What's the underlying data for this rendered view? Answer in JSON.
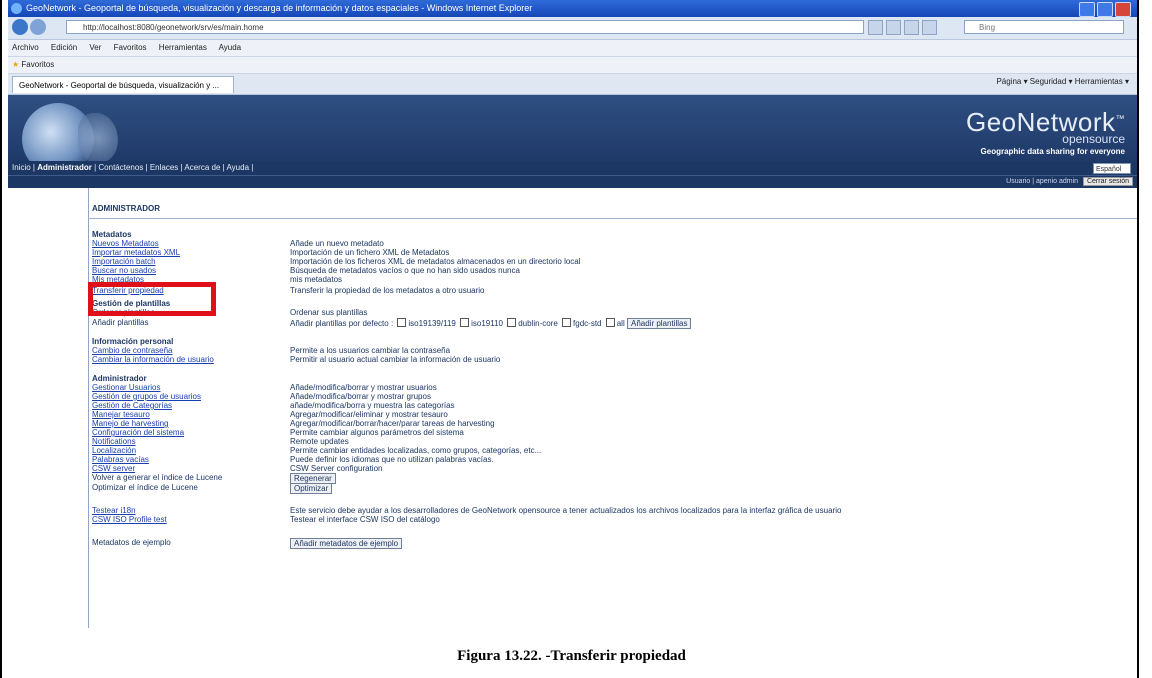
{
  "window": {
    "title": "GeoNetwork - Geoportal de búsqueda, visualización y descarga de información y datos espaciales - Windows Internet Explorer"
  },
  "address": {
    "url": "http://localhost:8080/geonetwork/srv/es/main.home",
    "search_placeholder": "Bing"
  },
  "menubar": [
    "Archivo",
    "Edición",
    "Ver",
    "Favoritos",
    "Herramientas",
    "Ayuda"
  ],
  "favorites": {
    "label": "Favoritos"
  },
  "tab": {
    "label": "GeoNetwork - Geoportal de búsqueda, visualización y ..."
  },
  "commandbar": {
    "text": "Página ▾  Seguridad ▾  Herramientas ▾"
  },
  "brand": {
    "name": "GeoNetwork",
    "tm": "™",
    "sub": "opensource",
    "tagline": "Geographic data sharing for everyone"
  },
  "nav": {
    "items": "Inicio | ",
    "active": "Administrador",
    "rest": " | Contáctenos | Enlaces | Acerca de | Ayuda |",
    "lang": "Español"
  },
  "userbar": {
    "text": "Usuario | apenio admin",
    "logout": "Cerrar sesión"
  },
  "admin": {
    "heading": "ADMINISTRADOR"
  },
  "sections": {
    "metadatos": "Metadatos",
    "plantillas": "Gestión de plantillas",
    "personal": "Información personal",
    "administrador": "Administrador"
  },
  "metadatos": [
    {
      "label": "Nuevos Metadatos",
      "desc": "Añade un nuevo metadato"
    },
    {
      "label": "Importar metadatos XML",
      "desc": "Importación de un fichero XML de Metadatos"
    },
    {
      "label": "Importación batch",
      "desc": "Importación de los ficheros XML de metadatos almacenados en un directorio local"
    },
    {
      "label": "Buscar no usados",
      "desc": "Búsqueda de metadatos vacíos o que no han sido usados nunca"
    },
    {
      "label": "Mis metadatos",
      "desc": "mis metadatos"
    },
    {
      "label": "Transferir propiedad",
      "desc": "Transferir la propiedad de los metadatos a otro usuario"
    }
  ],
  "plantillas": [
    {
      "label": "Ordenar plantillas",
      "desc": "Ordenar sus plantillas"
    },
    {
      "label": "Añadir plantillas",
      "desc": "Añadir plantillas por defecto :"
    }
  ],
  "template_options": [
    "iso19139/119",
    "iso19110",
    "dublin-core",
    "fgdc-std",
    "all"
  ],
  "template_button": "Añadir plantillas",
  "personal": [
    {
      "label": "Cambio de contraseña",
      "desc": "Permite a los usuarios cambiar la contraseña"
    },
    {
      "label": "Cambiar la información de usuario",
      "desc": "Permitir al usuario actual cambiar la información de usuario"
    }
  ],
  "administrador": [
    {
      "label": "Gestionar Usuarios",
      "desc": "Añade/modifica/borrar y mostrar usuarios"
    },
    {
      "label": "Gestión de grupos de usuarios",
      "desc": "Añade/modifica/borrar y mostrar grupos"
    },
    {
      "label": "Gestión de Categorías",
      "desc": "añade/modifica/borra y muestra las categorías"
    },
    {
      "label": "Manejar tesauro",
      "desc": "Agregar/modificar/eliminar y mostrar tesauro"
    },
    {
      "label": "Manejo de harvesting",
      "desc": "Agregar/modificar/borrar/hacer/parar tareas de harvesting"
    },
    {
      "label": "Configuración del sistema",
      "desc": "Permite cambiar algunos parámetros del sistema"
    },
    {
      "label": "Notifications",
      "desc": "Remote updates"
    },
    {
      "label": "Localización",
      "desc": "Permite cambiar entidades localizadas, como grupos, categorías, etc..."
    },
    {
      "label": "Palabras vacías",
      "desc": "Puede definir los idiomas que no utilizan palabras vacías."
    },
    {
      "label": "CSW server",
      "desc": "CSW Server configuration"
    },
    {
      "label": "Volver a generar el índice de Lucene",
      "desc": "Regenerar"
    },
    {
      "label": "Optimizar el índice de Lucene",
      "desc": "Optimizar"
    }
  ],
  "extra": [
    {
      "label": "Testear i18n",
      "desc": "Este servicio debe ayudar a los desarrolladores de GeoNetwork opensource a tener actualizados los archivos localizados para la interfaz gráfica de usuario"
    },
    {
      "label": "CSW ISO Profile test",
      "desc": "Testear el interface CSW ISO del catálogo"
    }
  ],
  "samples": {
    "label": "Metadatos de ejemplo",
    "button": "Añadir metadatos de ejemplo"
  },
  "caption": "Figura 13.22. -Transferir propiedad"
}
